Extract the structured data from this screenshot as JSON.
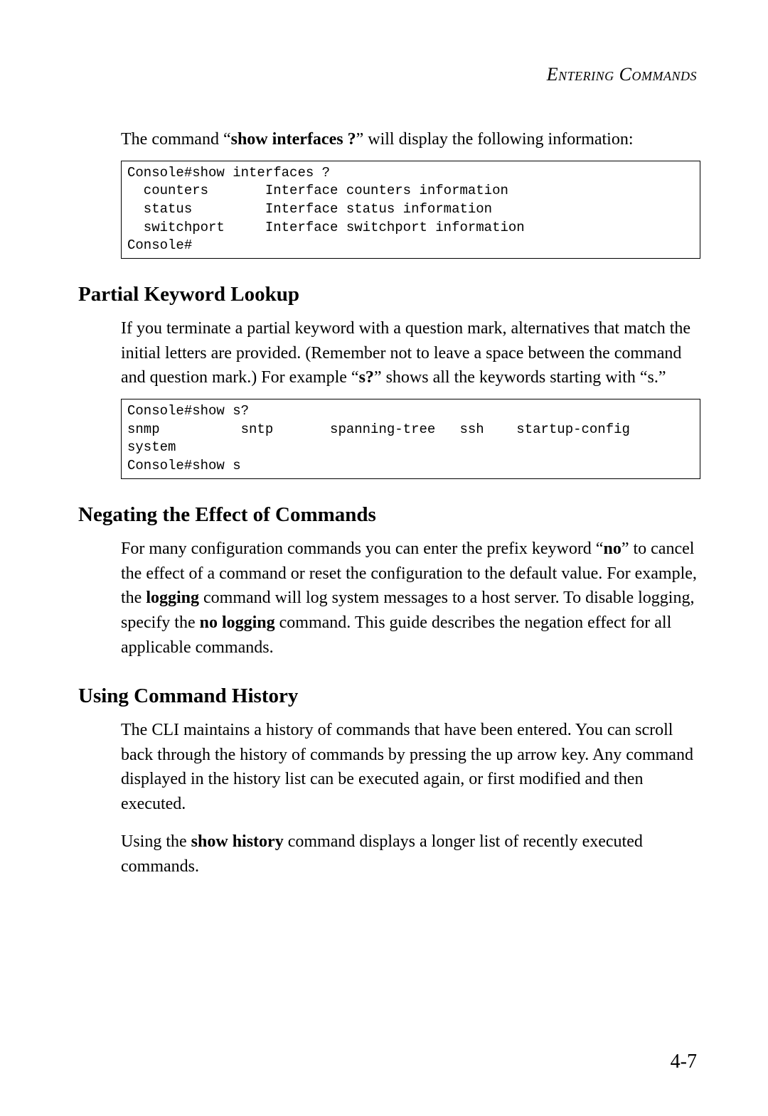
{
  "header": "Entering Commands",
  "intro": {
    "p1_a": "The command “",
    "p1_b": "show interfaces ?",
    "p1_c": "” will display the following information:"
  },
  "code1": "Console#show interfaces ?\n  counters       Interface counters information\n  status         Interface status information\n  switchport     Interface switchport information\nConsole#",
  "section1": {
    "heading": "Partial Keyword Lookup",
    "p1_a": "If you terminate a partial keyword with a question mark, alternatives that match the initial letters are provided. (Remember not to leave a space between the command and question mark.) For example “",
    "p1_b": "s?",
    "p1_c": "” shows all the keywords starting with “s.”"
  },
  "code2": "Console#show s?\nsnmp          sntp       spanning-tree   ssh    startup-config\nsystem\nConsole#show s",
  "section2": {
    "heading": "Negating the Effect of Commands",
    "p1_a": "For many configuration commands you can enter the prefix keyword “",
    "p1_b": "no",
    "p1_c": "” to cancel the effect of a command or reset the configuration to the default value. For example, the ",
    "p1_d": "logging",
    "p1_e": " command will log system messages to a host server. To disable logging, specify the ",
    "p1_f": "no logging",
    "p1_g": " command. This guide describes the negation effect for all applicable commands."
  },
  "section3": {
    "heading": "Using Command History",
    "p1": "The CLI maintains a history of commands that have been entered. You can scroll back through the history of commands by pressing the up arrow key. Any command displayed in the history list can be executed again, or first modified and then executed.",
    "p2_a": "Using the ",
    "p2_b": "show history",
    "p2_c": " command displays a longer list of recently executed commands."
  },
  "page_number": "4-7"
}
